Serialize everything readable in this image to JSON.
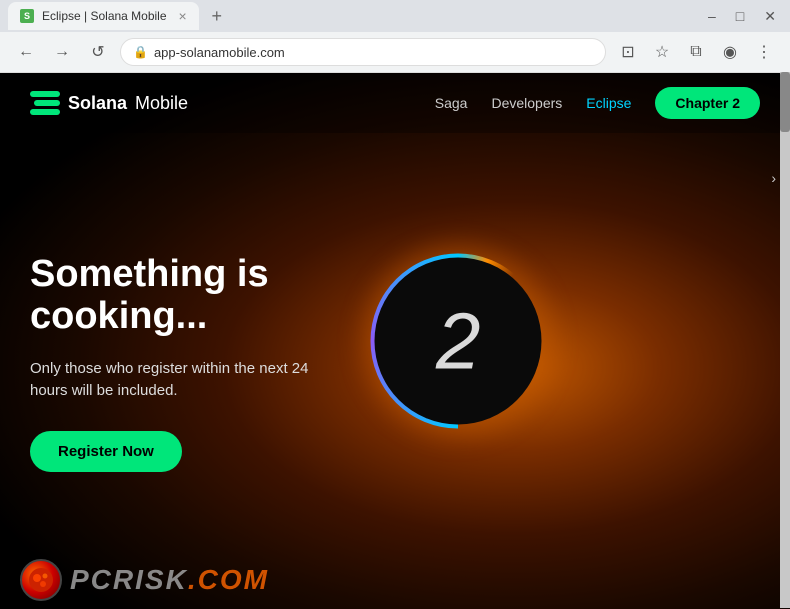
{
  "browser": {
    "tab": {
      "favicon_label": "S",
      "title": "Eclipse | Solana Mobile",
      "close_icon": "×"
    },
    "new_tab_icon": "+",
    "window_controls": {
      "minimize": "–",
      "maximize": "□",
      "close": "✕"
    },
    "nav": {
      "back_icon": "←",
      "forward_icon": "→",
      "reload_icon": "↺"
    },
    "url": "app-solanamobile.com",
    "toolbar": {
      "cast_icon": "⊡",
      "bookmark_icon": "☆",
      "extensions_icon": "⧉",
      "profile_icon": "◉",
      "menu_icon": "⋮"
    }
  },
  "site": {
    "logo": {
      "symbol": "S",
      "name_solana": "Solana",
      "name_mobile": "Mobile"
    },
    "nav_links": [
      {
        "id": "saga",
        "label": "Saga"
      },
      {
        "id": "developers",
        "label": "Developers"
      },
      {
        "id": "eclipse",
        "label": "Eclipse"
      }
    ],
    "cta_button": "Chapter 2",
    "headline": "Something is cooking...",
    "subtext": "Only those who register within the next 24 hours will be included.",
    "register_button": "Register Now",
    "eclipse_number": "2"
  },
  "watermark": {
    "site": "risk.com",
    "prefix": "PC"
  }
}
